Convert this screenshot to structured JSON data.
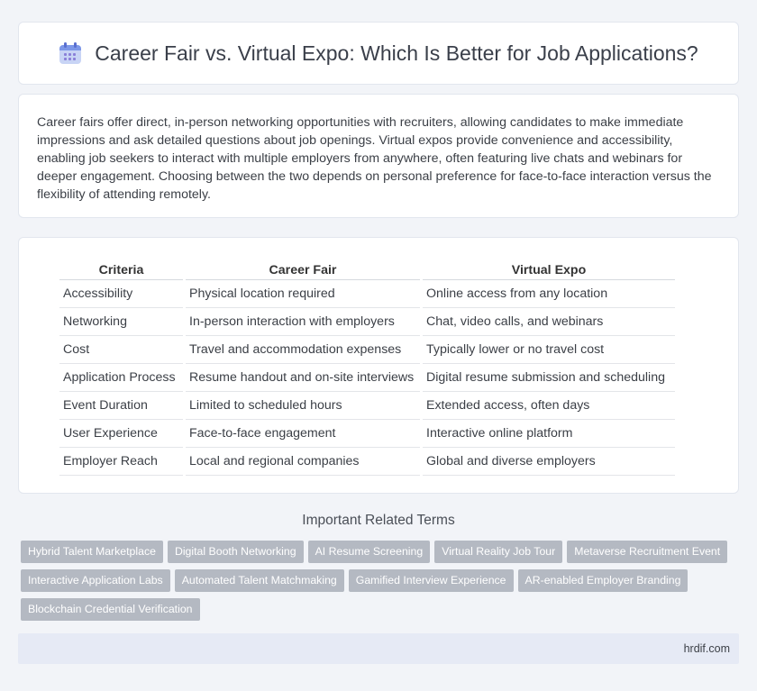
{
  "header": {
    "title": "Career Fair vs. Virtual Expo: Which Is Better for Job Applications?",
    "icon": "calendar-icon"
  },
  "intro": {
    "text": "Career fairs offer direct, in-person networking opportunities with recruiters, allowing candidates to make immediate impressions and ask detailed questions about job openings. Virtual expos provide convenience and accessibility, enabling job seekers to interact with multiple employers from anywhere, often featuring live chats and webinars for deeper engagement. Choosing between the two depends on personal preference for face-to-face interaction versus the flexibility of attending remotely."
  },
  "table": {
    "headers": [
      "Criteria",
      "Career Fair",
      "Virtual Expo"
    ],
    "rows": [
      [
        "Accessibility",
        "Physical location required",
        "Online access from any location"
      ],
      [
        "Networking",
        "In-person interaction with employers",
        "Chat, video calls, and webinars"
      ],
      [
        "Cost",
        "Travel and accommodation expenses",
        "Typically lower or no travel cost"
      ],
      [
        "Application Process",
        "Resume handout and on-site interviews",
        "Digital resume submission and scheduling"
      ],
      [
        "Event Duration",
        "Limited to scheduled hours",
        "Extended access, often days"
      ],
      [
        "User Experience",
        "Face-to-face engagement",
        "Interactive online platform"
      ],
      [
        "Employer Reach",
        "Local and regional companies",
        "Global and diverse employers"
      ]
    ]
  },
  "related": {
    "title": "Important Related Terms",
    "tags": [
      "Hybrid Talent Marketplace",
      "Digital Booth Networking",
      "AI Resume Screening",
      "Virtual Reality Job Tour",
      "Metaverse Recruitment Event",
      "Interactive Application Labs",
      "Automated Talent Matchmaking",
      "Gamified Interview Experience",
      "AR-enabled Employer Branding",
      "Blockchain Credential Verification"
    ]
  },
  "footer": {
    "site": "hrdif.com"
  },
  "colors": {
    "background": "#f2f4f8",
    "tag": "#b4b9c2",
    "footer": "#e6eaf5",
    "icon_accent": "#7d97e8"
  }
}
